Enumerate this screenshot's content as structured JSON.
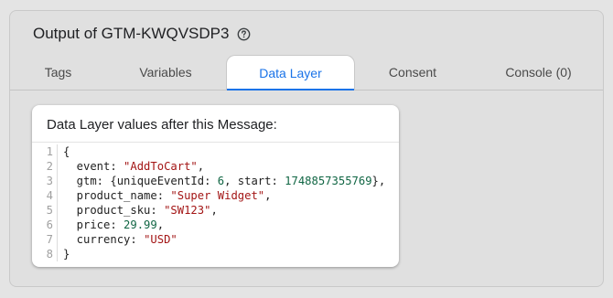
{
  "header": {
    "title": "Output of GTM-KWQVSDP3",
    "help_icon": "help-circle-icon"
  },
  "tabs": [
    {
      "label": "Tags",
      "active": false
    },
    {
      "label": "Variables",
      "active": false
    },
    {
      "label": "Data Layer",
      "active": true
    },
    {
      "label": "Consent",
      "active": false
    },
    {
      "label": "Console (0)",
      "active": false
    }
  ],
  "card": {
    "title": "Data Layer values after this Message:",
    "code": [
      {
        "n": "1",
        "tokens": [
          {
            "t": "{",
            "k": "txt"
          }
        ]
      },
      {
        "n": "2",
        "tokens": [
          {
            "t": "  event: ",
            "k": "txt"
          },
          {
            "t": "\"AddToCart\"",
            "k": "str"
          },
          {
            "t": ",",
            "k": "txt"
          }
        ]
      },
      {
        "n": "3",
        "tokens": [
          {
            "t": "  gtm: {uniqueEventId: ",
            "k": "txt"
          },
          {
            "t": "6",
            "k": "num"
          },
          {
            "t": ", start: ",
            "k": "txt"
          },
          {
            "t": "1748857355769",
            "k": "num"
          },
          {
            "t": "},",
            "k": "txt"
          }
        ]
      },
      {
        "n": "4",
        "tokens": [
          {
            "t": "  product_name: ",
            "k": "txt"
          },
          {
            "t": "\"Super Widget\"",
            "k": "str"
          },
          {
            "t": ",",
            "k": "txt"
          }
        ]
      },
      {
        "n": "5",
        "tokens": [
          {
            "t": "  product_sku: ",
            "k": "txt"
          },
          {
            "t": "\"SW123\"",
            "k": "str"
          },
          {
            "t": ",",
            "k": "txt"
          }
        ]
      },
      {
        "n": "6",
        "tokens": [
          {
            "t": "  price: ",
            "k": "txt"
          },
          {
            "t": "29.99",
            "k": "num"
          },
          {
            "t": ",",
            "k": "txt"
          }
        ]
      },
      {
        "n": "7",
        "tokens": [
          {
            "t": "  currency: ",
            "k": "txt"
          },
          {
            "t": "\"USD\"",
            "k": "str"
          }
        ]
      },
      {
        "n": "8",
        "tokens": [
          {
            "t": "}",
            "k": "txt"
          }
        ]
      }
    ]
  },
  "colors": {
    "accent": "#1a73e8",
    "string": "#a31515",
    "number": "#116644"
  }
}
